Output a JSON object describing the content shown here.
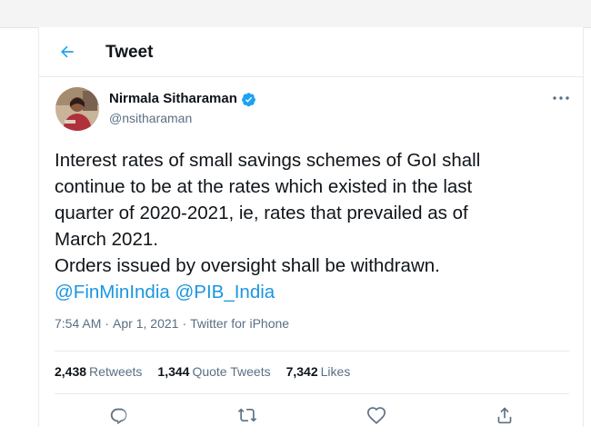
{
  "header": {
    "title": "Tweet",
    "back_icon": "arrow-left-icon"
  },
  "tweet": {
    "author": {
      "display_name": "Nirmala Sitharaman",
      "handle": "@nsitharaman",
      "verified": true
    },
    "text_lines": [
      "Interest rates of small savings schemes of GoI shall",
      "continue to be at the rates which existed in the last",
      "quarter of 2020-2021, ie, rates that prevailed as of",
      "March 2021.",
      "Orders issued by oversight shall be withdrawn."
    ],
    "mentions": [
      "@FinMinIndia",
      "@PIB_India"
    ],
    "time": "7:54 AM",
    "date": "Apr 1, 2021",
    "source": "Twitter for iPhone",
    "separator": "·",
    "stats": {
      "retweets": {
        "count": "2,438",
        "label": "Retweets"
      },
      "quote_tweets": {
        "count": "1,344",
        "label": "Quote Tweets"
      },
      "likes": {
        "count": "7,342",
        "label": "Likes"
      }
    }
  },
  "colors": {
    "accent": "#1da1f2",
    "link": "#1b95e0",
    "text": "#0f1419",
    "secondary": "#5b7083",
    "border": "#e6ecf0"
  }
}
